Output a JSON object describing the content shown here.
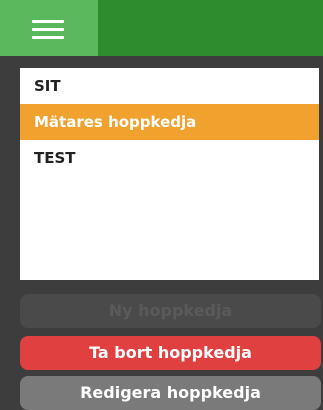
{
  "header": {
    "menu_icon": "hamburger-menu-icon"
  },
  "list": {
    "items": [
      {
        "label": "SIT"
      },
      {
        "label": "Mätares hoppkedja"
      },
      {
        "label": "TEST"
      }
    ],
    "selected_index": 1
  },
  "buttons": {
    "new_label": "Ny hoppkedja",
    "delete_label": "Ta bort hoppkedja",
    "edit_label": "Redigera hoppkedja"
  },
  "colors": {
    "header_bg": "#2e8b2e",
    "menu_button_bg": "#5cb85c",
    "selected_item_bg": "#f0a12e",
    "delete_button_bg": "#e04040",
    "edit_button_bg": "#7a7a7a",
    "disabled_button_bg": "#4a4a4a",
    "page_bg": "#3d3d3d"
  }
}
